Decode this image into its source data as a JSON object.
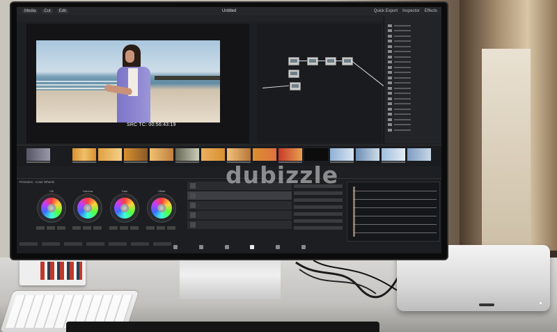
{
  "resolve": {
    "project_title": "Untitled",
    "workspace_tabs": [
      "Media",
      "Cut",
      "Edit"
    ],
    "right_buttons": [
      "Quick Export",
      "Inspector",
      "Effects"
    ],
    "viewer_timecode": "SRC TC: 00:56:43:19",
    "color_panel_label": "Primaries - Color Wheels",
    "wheel_labels": [
      "Lift",
      "Gamma",
      "Gain",
      "Offset"
    ]
  },
  "watermark": "dubizzle",
  "colors": {
    "screen_bg": "#1e1f22",
    "panel_bg": "#232428",
    "accent_clip_orange": "#d9902f",
    "accent_clip_blue": "#6c8fb5",
    "cardigan": "#8c86d2"
  },
  "icons": [
    "node-icon",
    "color-wheel-icon",
    "page-tab-icon"
  ]
}
